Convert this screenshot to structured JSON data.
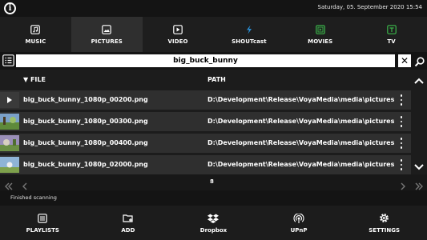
{
  "header": {
    "datetime": "Saturday, 05. September 2020 15:54"
  },
  "tabs": [
    {
      "label": "MUSIC",
      "icon": "music-icon",
      "active": false
    },
    {
      "label": "PICTURES",
      "icon": "pictures-icon",
      "active": true
    },
    {
      "label": "VIDEO",
      "icon": "video-icon",
      "active": false
    },
    {
      "label": "SHOUTcast",
      "icon": "shoutcast-icon",
      "active": false
    },
    {
      "label": "MOVIES",
      "icon": "movies-icon",
      "active": false
    },
    {
      "label": "TV",
      "icon": "tv-icon",
      "active": false
    }
  ],
  "search": {
    "value": "big_buck_bunny",
    "clear_label": "✕"
  },
  "list": {
    "columns": {
      "file": "▼ FILE",
      "path": "PATH"
    },
    "rows": [
      {
        "file": "big_buck_bunny_1080p_00200.png",
        "path": "D:\\Development\\Release\\VoyaMedia\\media\\pictures"
      },
      {
        "file": "big_buck_bunny_1080p_00300.png",
        "path": "D:\\Development\\Release\\VoyaMedia\\media\\pictures"
      },
      {
        "file": "big_buck_bunny_1080p_00400.png",
        "path": "D:\\Development\\Release\\VoyaMedia\\media\\pictures"
      },
      {
        "file": "big_buck_bunny_1080p_02000.png",
        "path": "D:\\Development\\Release\\VoyaMedia\\media\\pictures"
      }
    ]
  },
  "pager": {
    "page": "8"
  },
  "status": {
    "text": "Finished scanning"
  },
  "toolbar": [
    {
      "label": "PLAYLISTS",
      "icon": "playlists-icon"
    },
    {
      "label": "ADD",
      "icon": "add-folder-icon"
    },
    {
      "label": "Dropbox",
      "icon": "dropbox-icon"
    },
    {
      "label": "UPnP",
      "icon": "upnp-icon"
    },
    {
      "label": "SETTINGS",
      "icon": "settings-icon"
    }
  ],
  "colors": {
    "background": "#1c1c1c",
    "row": "#2f2f2f",
    "active_tab": "#2f2f2f",
    "shoutcast_accent": "#2a8fd6",
    "movies_tv_accent": "#3bb54a"
  }
}
